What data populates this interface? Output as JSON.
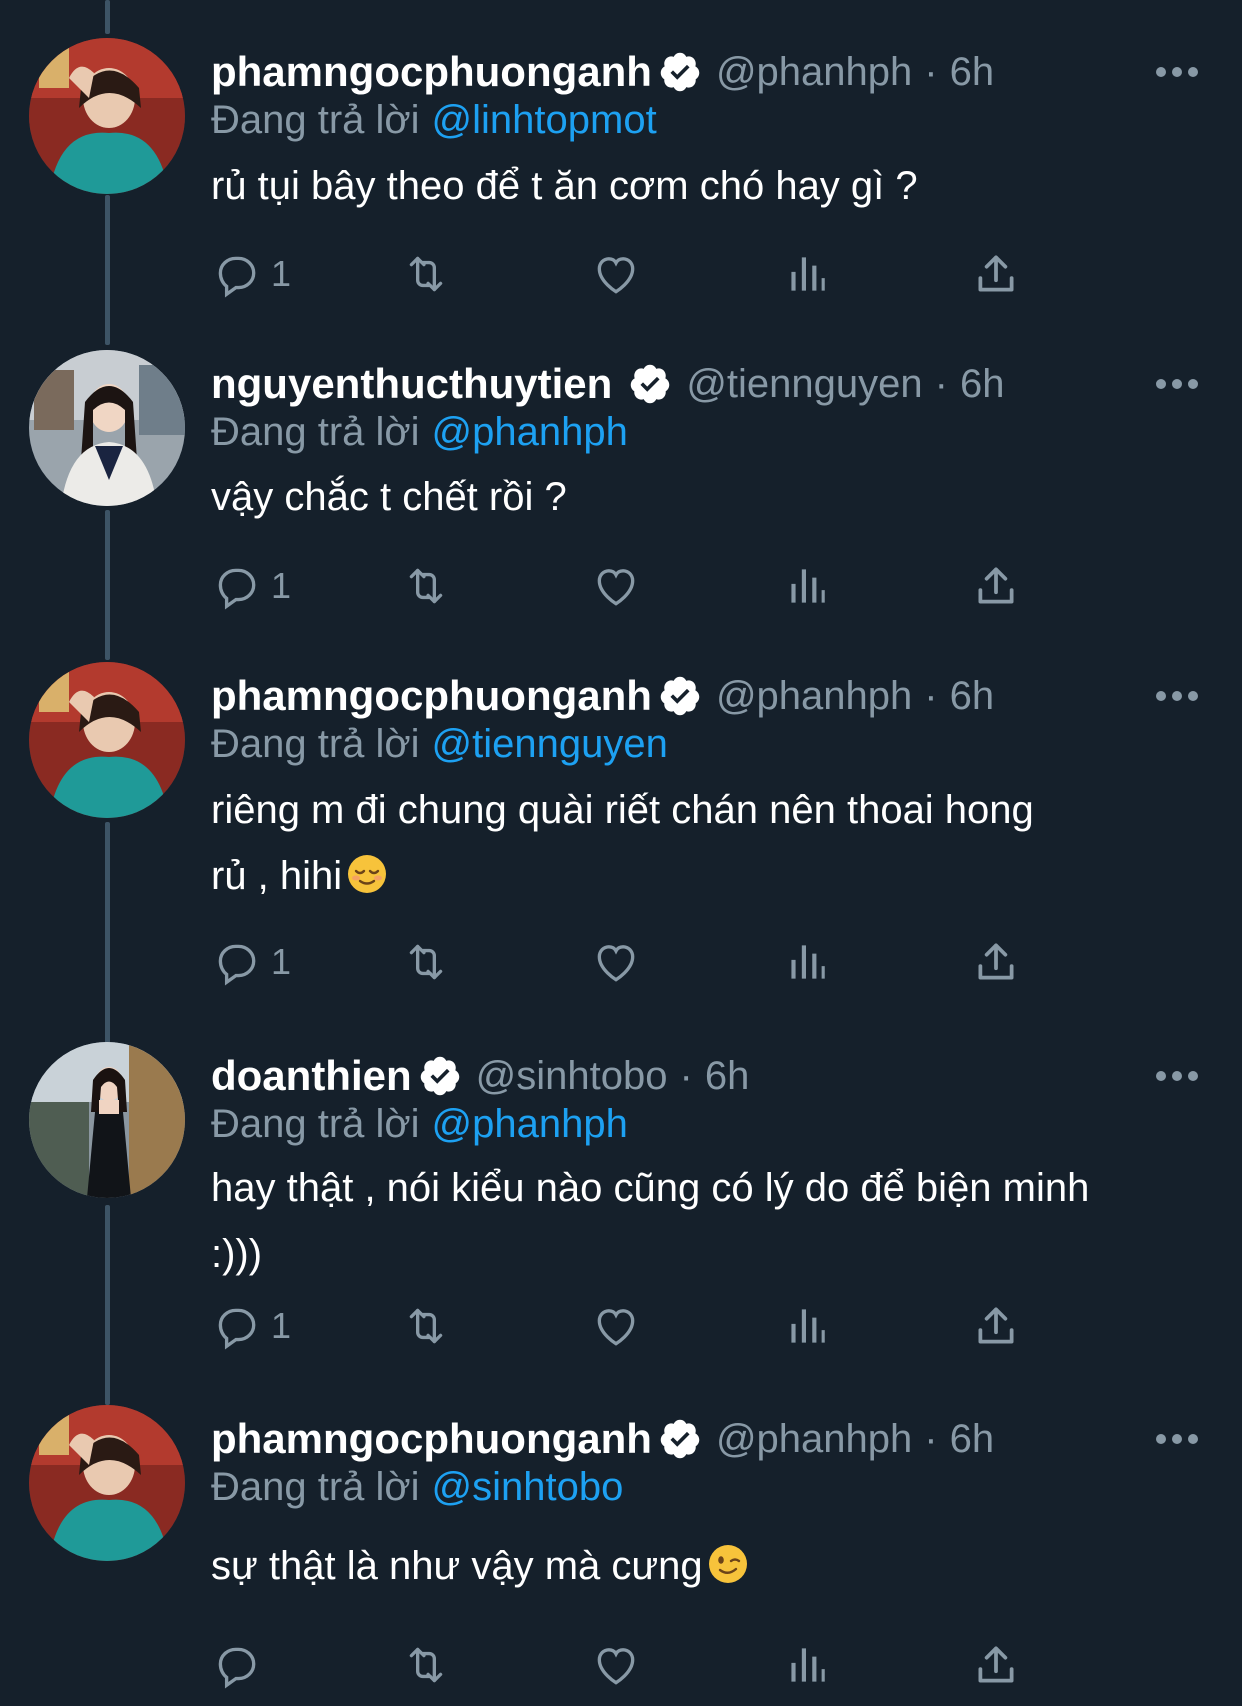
{
  "theme": {
    "background": "#15202b",
    "text_primary": "#ffffff",
    "text_secondary": "#8899a6",
    "accent": "#1da1f2",
    "thread_line": "#3d5466"
  },
  "icons": {
    "verified": "verified-badge-icon",
    "more": "more-horizontal-icon",
    "reply": "speech-bubble-icon",
    "retweet": "retweet-arrows-icon",
    "like": "heart-icon",
    "views": "bar-chart-icon",
    "share": "share-upload-icon"
  },
  "reply_prefix": "Đang trả lời",
  "tweets": [
    {
      "display_name": "phamngocphuonganh",
      "handle": "@phanhph",
      "separator": "·",
      "time": "6h",
      "reply_prefix": "Đang trả lời",
      "reply_to": "@linhtopmot",
      "text": "rủ tụi bây theo để t ăn cơm chó hay gì ?",
      "emoji": "",
      "reply_count": "1"
    },
    {
      "display_name": "nguyenthucthuytien",
      "handle": "@tiennguyen",
      "separator": "·",
      "time": "6h",
      "reply_prefix": "Đang trả lời",
      "reply_to": "@phanhph",
      "text": "vậy chắc t chết rồi ?",
      "emoji": "",
      "reply_count": "1"
    },
    {
      "display_name": "phamngocphuonganh",
      "handle": "@phanhph",
      "separator": "·",
      "time": "6h",
      "reply_prefix": "Đang trả lời",
      "reply_to": "@tiennguyen",
      "text": "riêng m đi chung quài riết chán nên thoai hong\nrủ , hihi",
      "emoji": "relieved-face",
      "reply_count": "1"
    },
    {
      "display_name": "doanthien",
      "handle": "@sinhtobo",
      "separator": "·",
      "time": "6h",
      "reply_prefix": "Đang trả lời",
      "reply_to": "@phanhph",
      "text": "hay thật , nói kiểu nào cũng có lý do để biện minh\n:)))",
      "emoji": "",
      "reply_count": "1"
    },
    {
      "display_name": "phamngocphuonganh",
      "handle": "@phanhph",
      "separator": "·",
      "time": "6h",
      "reply_prefix": "Đang trả lời",
      "reply_to": "@sinhtobo",
      "text": "sự thật là như vậy mà cưng",
      "emoji": "winking-face",
      "reply_count": ""
    }
  ]
}
